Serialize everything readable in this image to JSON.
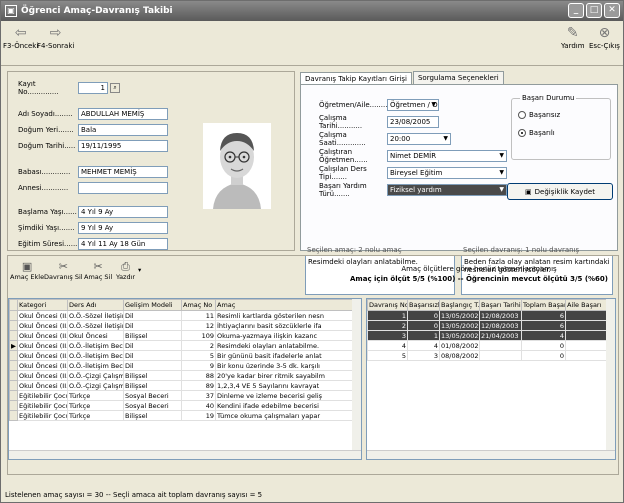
{
  "window": {
    "title": "Öğrenci Amaç-Davranış Takibi"
  },
  "toolbar": {
    "prev": "F3-Önceki",
    "next": "F4-Sonraki",
    "help": "Yardım",
    "exit": "Esc-Çıkış"
  },
  "student": {
    "kayit_label": "Kayıt No..............",
    "kayit_value": "1",
    "ad_label": "Adı Soyadı........",
    "ad_value": "ABDULLAH MEMİŞ",
    "dogum_yeri_label": "Doğum Yeri.......",
    "dogum_yeri_value": "Bala",
    "dogum_tarihi_label": "Doğum Tarihi.....",
    "dogum_tarihi_value": "19/11/1995",
    "baba_label": "Babası.............",
    "baba_value": "MEHMET MEMİŞ",
    "anne_label": "Annesi............",
    "anne_value": "",
    "baslama_label": "Başlama Yaşı......",
    "baslama_value": "4 Yıl 9 Ay",
    "simdiki_label": "Şimdiki Yaşı.......",
    "simdiki_value": "9 Yıl 9 Ay",
    "egitim_label": "Eğitim Süresi......",
    "egitim_value": "4 Yıl 11 Ay 18 Gün"
  },
  "tabs": [
    "Davranış Takip Kayıtları Girişi",
    "Sorgulama Seçenekleri"
  ],
  "form": {
    "ogretmen_label": "Öğretmen/Aile...........",
    "ogretmen_value": "Öğretmen / O",
    "calisma_tarihi_label": "Çalışma Tarihi...........",
    "calisma_tarihi_value": "23/08/2005",
    "calisma_saati_label": "Çalışma Saati.............",
    "calisma_saati_value": "20:00",
    "calistiran_label": "Çalıştıran Öğretmen......",
    "calistiran_value": "Nimet DEMİR",
    "ders_label": "Çalışılan Ders Tipi.......",
    "ders_value": "Bireysel Eğitim",
    "yardim_label": "Başarı Yardım Türü.......",
    "yardim_value": "Fiziksel yardım",
    "basari_title": "Başarı Durumu",
    "basarisiz": "Başarısız",
    "basarili": "Başarılı",
    "save": "Değişiklik Kaydet",
    "secilen_amac": "Seçilen amaç: 2 nolu amaç",
    "secilen_davranis": "Seçilen davranış: 1 nolu davranış",
    "amac_text": "Resimdeki olayları anlatabilme.",
    "davranis_text": "Beden fazla olay anlatan resim kartındaki nesneleri gösterir/söyler."
  },
  "bottom_toolbar": {
    "add": "Amaç Ekle",
    "del_beh": "Davranış Sil",
    "del_goal": "Amaç Sil",
    "print": "Yazdır"
  },
  "summary": {
    "line1": "Amaç ölçütlere göre henüz tamamlanmamış",
    "line2": "Amaç için ölçüt 5/5 (%100) -- Öğrencinin mevcut ölçütü 3/5 (%60)"
  },
  "goals": {
    "headers": [
      "Kategori",
      "Ders Adı",
      "Gelişim Modeli",
      "Amaç No",
      "Amaç"
    ],
    "rows": [
      [
        "Okul Öncesi (II.Kad",
        "O.Ö.-Sözel İletişim E",
        "Dil",
        "11",
        "Resimli kartlarda gösterilen nesn"
      ],
      [
        "Okul Öncesi (II.Kad",
        "O.Ö.-Sözel İletişim E",
        "Dil",
        "12",
        "İhtiyaçlarını basit sözcüklerle ifa"
      ],
      [
        "Okul Öncesi (II.Kad",
        "Okul Öncesi",
        "Bilişsel",
        "109",
        "Okuma-yazmaya ilişkin kazanc"
      ],
      [
        "Okul Öncesi (II.Kad",
        "O.Ö.-İletişim Beceri",
        "Dil",
        "2",
        "Resimdeki olayları anlatabilme."
      ],
      [
        "Okul Öncesi (II.Kad",
        "O.Ö.-İletişim Beceri",
        "Dil",
        "5",
        "Bir gününü basit ifadelerle anlat"
      ],
      [
        "Okul Öncesi (II.Kad",
        "O.Ö.-İletişim Beceri",
        "Dil",
        "9",
        "Bir konu üzerinde 3-5 dk. karşılı"
      ],
      [
        "Okul Öncesi (II.Kad",
        "O.Ö.-Çizgi Çalışmala",
        "Bilişsel",
        "88",
        "20'ye kadar birer ritmik sayabilm"
      ],
      [
        "Okul Öncesi (II.Kad",
        "O.Ö.-Çizgi Çalışmala",
        "Bilişsel",
        "89",
        "1,2,3,4 VE 5 Sayılarını kavrayat"
      ],
      [
        "Eğitilebilir Çocuklar",
        "Türkçe",
        "Sosyal Beceri",
        "37",
        "Dinleme ve izleme becerisi geliş"
      ],
      [
        "Eğitilebilir Çocuklar",
        "Türkçe",
        "Sosyal Beceri",
        "40",
        "Kendini ifade edebilme becerisi"
      ],
      [
        "Eğitilebilir Çocuklar",
        "Türkçe",
        "Bilişsel",
        "19",
        "Tümce okuma çalışmaları yapar"
      ]
    ]
  },
  "behaviors": {
    "headers": [
      "Davranış No",
      "Başarısızlık",
      "Başlangıç T.",
      "Başarı Tarihi",
      "Toplam Başarı",
      "Aile Başarı"
    ],
    "rows": [
      [
        "1",
        "0",
        "13/05/2002",
        "12/08/2003",
        "6",
        ""
      ],
      [
        "2",
        "0",
        "13/05/2002",
        "12/08/2003",
        "6",
        ""
      ],
      [
        "3",
        "1",
        "13/05/2002",
        "21/04/2003",
        "4",
        ""
      ],
      [
        "4",
        "4",
        "01/08/2002",
        "",
        "0",
        ""
      ],
      [
        "5",
        "3",
        "08/08/2002",
        "",
        "0",
        ""
      ]
    ]
  },
  "status": "Listelenen amaç sayısı = 30 -- Seçli amaca ait toplam davranış sayısı = 5"
}
